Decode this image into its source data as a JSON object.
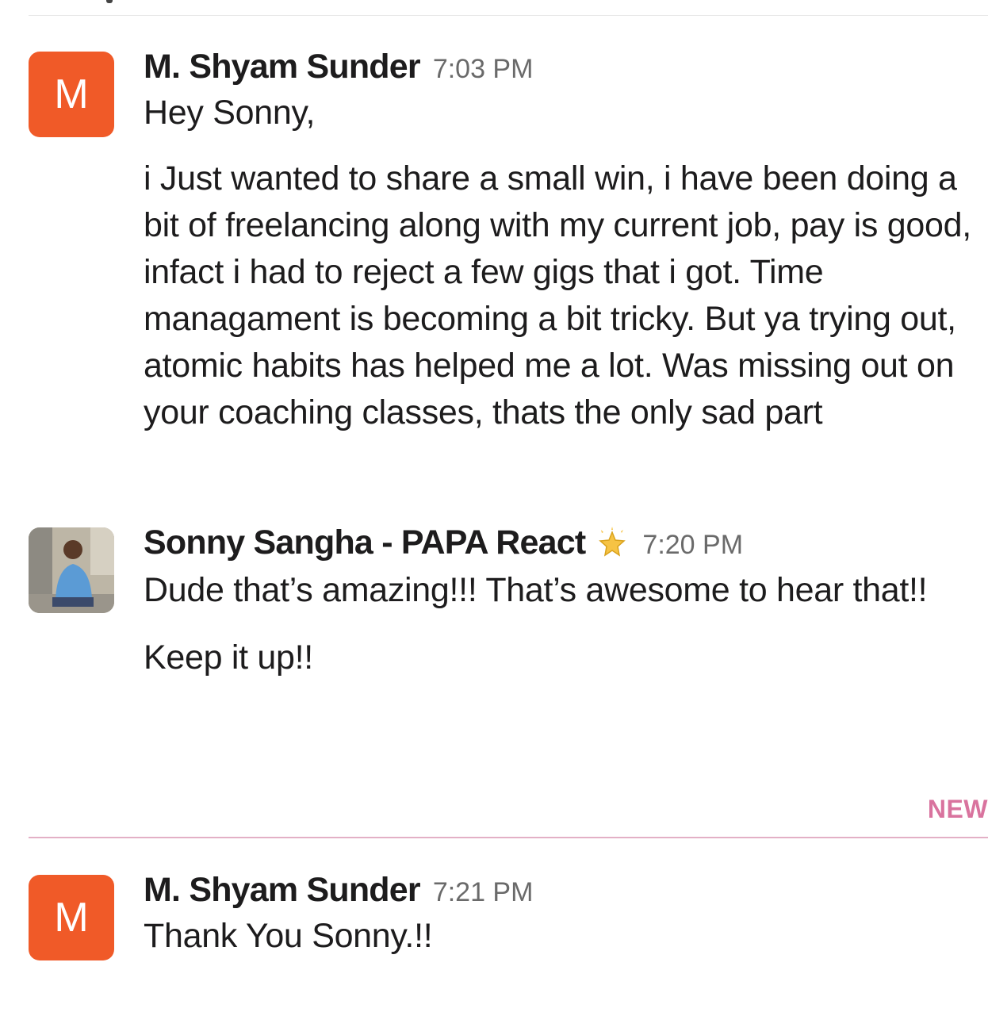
{
  "messages": [
    {
      "sender": "M. Shyam Sunder",
      "time": "7:03 PM",
      "avatar_letter": "M",
      "paragraphs": [
        "Hey Sonny,",
        "i Just wanted to share a small win, i have been doing a bit of freelancing along with my current job, pay is good, infact i had to reject a few gigs that i got. Time managament is becoming a bit tricky. But ya trying out, atomic habits has helped me a lot. Was missing out on your coaching classes, thats the only sad part"
      ]
    },
    {
      "sender": "Sonny Sangha - PAPA React",
      "time": "7:20 PM",
      "status_icon": "sparkle-star-icon",
      "paragraphs": [
        "Dude that’s amazing!!! That’s awesome to hear that!!",
        "Keep it up!!"
      ]
    },
    {
      "sender": "M. Shyam Sunder",
      "time": "7:21 PM",
      "avatar_letter": "M",
      "paragraphs": [
        "Thank You Sonny.!!"
      ]
    }
  ],
  "new_divider": {
    "label": "NEW"
  },
  "colors": {
    "avatar_bg": "#f05a28",
    "new_label": "#d9739e",
    "new_line": "#e3b0c6",
    "timestamp": "#6a6a6a",
    "text": "#1d1c1d"
  }
}
